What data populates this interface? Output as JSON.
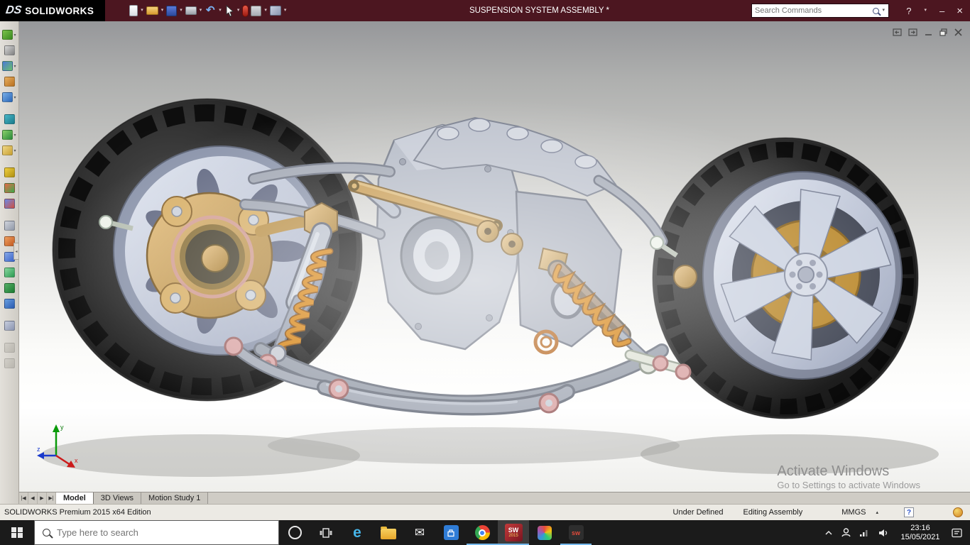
{
  "colors": {
    "titlebar_maroon": "#4c1620",
    "logo_black": "#000000",
    "gold_parts": "#c79a50",
    "spring_orange": "#c96f12",
    "rim_silver": "#c3cada",
    "tire_dark": "#232323",
    "taskbar_dark": "#1b1b1b",
    "viewport_gray_top": "#96979a",
    "active_app_underline": "#76b9ed"
  },
  "ui": {
    "caret_down": "▾",
    "caret_up": "▴",
    "undo_glyph": "↶",
    "nav_first": "|◀",
    "nav_prev": "◀",
    "nav_next": "▶",
    "nav_last": "▶|",
    "flyout_glyph": "◂"
  },
  "title_bar": {
    "logo_ds": "DS",
    "logo_text": "SOLIDWORKS",
    "document_title": "SUSPENSION SYSTEM ASSEMBLY *",
    "search_placeholder": "Search Commands",
    "help_label": "?",
    "minimize_label": "–",
    "close_label": "×"
  },
  "quick_toolbar_icons": [
    "new-document",
    "open",
    "save",
    "print",
    "undo",
    "select",
    "rebuild",
    "options",
    "show-display-pane"
  ],
  "left_toolbar_icons": [
    "edit-component",
    "sketch",
    "evaluate",
    "new-part",
    "rotate-view",
    "mate",
    "insert-component",
    "smart-fasteners",
    "configurations",
    "move-component",
    "exploded-view",
    "section-view",
    "assembly-features",
    "linear-pattern",
    "component-pattern",
    "design-library",
    "measure",
    "mass-properties",
    "fix-component",
    "float-component"
  ],
  "viewport": {
    "watermark_title": "Activate Windows",
    "watermark_subtitle": "Go to Settings to activate Windows",
    "triad_x": "x",
    "triad_y": "y",
    "triad_z": "z"
  },
  "document_tabs": {
    "tabs": [
      {
        "label": "Model",
        "active": true
      },
      {
        "label": "3D Views",
        "active": false
      },
      {
        "label": "Motion Study 1",
        "active": false
      }
    ]
  },
  "status_bar": {
    "edition": "SOLIDWORKS Premium 2015 x64 Edition",
    "constraint_status": "Under Defined",
    "mode": "Editing Assembly",
    "units": "MMGS",
    "help_glyph": "?"
  },
  "taskbar": {
    "search_placeholder": "Type here to search",
    "edge_glyph": "e",
    "mail_glyph": "✉",
    "solidworks_glyph": "SW",
    "solidworks_year": "2015",
    "edrawings_glyph": "sw",
    "clock_time": "23:16",
    "clock_date": "15/05/2021"
  }
}
